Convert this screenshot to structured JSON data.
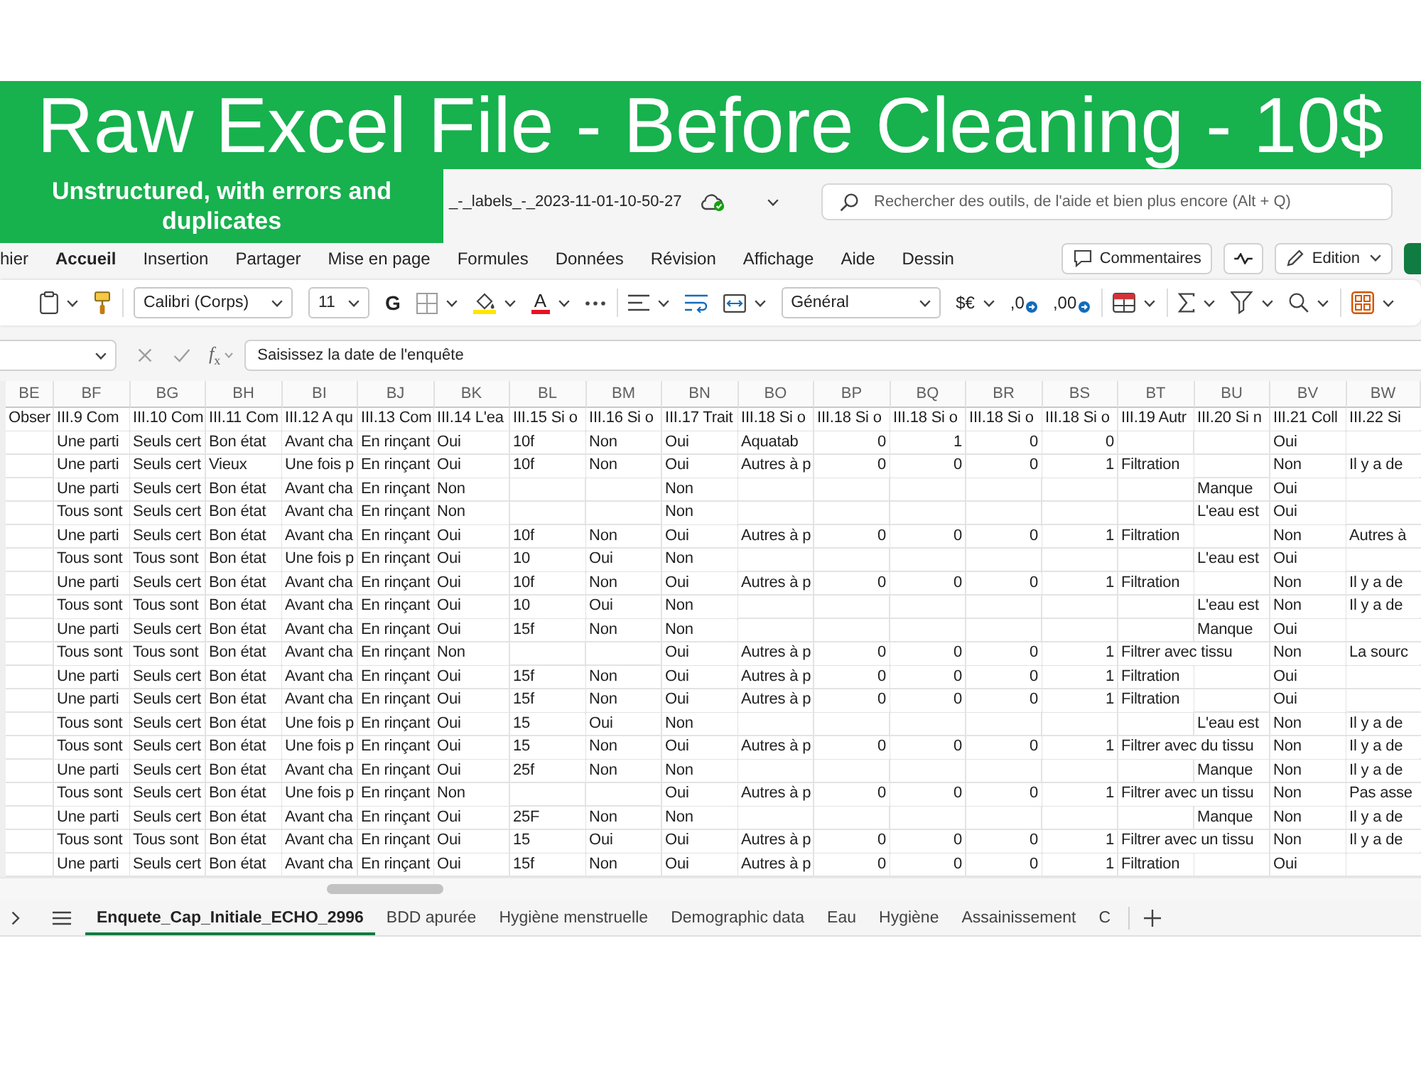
{
  "banner": {
    "title": "Raw Excel File - Before Cleaning - 10$",
    "note": "Unstructured, with errors and duplicates"
  },
  "title_bar": {
    "file_name": "_-_labels_-_2023-11-01-10-50-27",
    "search": {
      "placeholder": "Rechercher des outils, de l'aide et bien plus encore (Alt + Q)"
    }
  },
  "menu_tabs": [
    {
      "label": "hier",
      "selected": false
    },
    {
      "label": "Accueil",
      "selected": true
    },
    {
      "label": "Insertion",
      "selected": false
    },
    {
      "label": "Partager",
      "selected": false
    },
    {
      "label": "Mise en page",
      "selected": false
    },
    {
      "label": "Formules",
      "selected": false
    },
    {
      "label": "Données",
      "selected": false
    },
    {
      "label": "Révision",
      "selected": false
    },
    {
      "label": "Affichage",
      "selected": false
    },
    {
      "label": "Aide",
      "selected": false
    },
    {
      "label": "Dessin",
      "selected": false
    }
  ],
  "menu_actions": [
    {
      "kind": "comments",
      "label": "Commentaires"
    },
    {
      "kind": "activity"
    },
    {
      "kind": "editing",
      "label": "Edition"
    },
    {
      "kind": "share"
    }
  ],
  "ribbon": [
    {
      "kind": "clipboard"
    },
    {
      "kind": "format-painter"
    },
    {
      "kind": "separator"
    },
    {
      "kind": "font",
      "value": "Calibri (Corps)"
    },
    {
      "kind": "size",
      "value": "11"
    },
    {
      "kind": "bold",
      "label": "G"
    },
    {
      "kind": "borders"
    },
    {
      "kind": "fill-color"
    },
    {
      "kind": "font-color",
      "label": "A"
    },
    {
      "kind": "more"
    },
    {
      "kind": "separator"
    },
    {
      "kind": "align"
    },
    {
      "kind": "wrap"
    },
    {
      "kind": "merge"
    },
    {
      "kind": "number-format",
      "value": "Général"
    },
    {
      "kind": "currency",
      "label": "$€"
    },
    {
      "kind": "add-decimal",
      "label": ",0"
    },
    {
      "kind": "remove-decimal",
      "label": ",00"
    },
    {
      "kind": "separator"
    },
    {
      "kind": "cell-format"
    },
    {
      "kind": "separator"
    },
    {
      "kind": "sum"
    },
    {
      "kind": "sort-filter"
    },
    {
      "kind": "find"
    },
    {
      "kind": "separator"
    },
    {
      "kind": "styles"
    }
  ],
  "formula_bar": {
    "function_label": "*f*$_{x}$",
    "value": "Saisissez la date de l'enquête"
  },
  "sheet": {
    "columns": [
      {
        "label": "BE"
      },
      {
        "label": "BF",
        "numeric": false
      },
      {
        "label": "BG",
        "numeric": false
      },
      {
        "label": "BH",
        "numeric": false
      },
      {
        "label": "BI",
        "numeric": false
      },
      {
        "label": "BJ"
      },
      {
        "label": "BK",
        "numeric": false
      },
      {
        "label": "BL",
        "numeric": false
      },
      {
        "label": "BM",
        "numeric": false
      },
      {
        "label": "BN",
        "numeric": false
      },
      {
        "label": "BO",
        "numeric": false
      },
      {
        "label": "BP",
        "numeric": true
      },
      {
        "label": "BQ",
        "numeric": true
      },
      {
        "label": "BR",
        "numeric": true
      },
      {
        "label": "BS",
        "numeric": true
      },
      {
        "label": "BT",
        "numeric": false
      },
      {
        "label": "BU",
        "numeric": false
      },
      {
        "label": "BV",
        "numeric": false
      },
      {
        "label": "BW",
        "numeric": false
      }
    ],
    "header_row": [
      "Obser",
      "III.9 Com",
      "III.10 Com",
      "III.11 Com",
      "III.12 A qu",
      "III.13 Com",
      "III.14 L'ea",
      "III.15 Si o",
      "III.16 Si o",
      "III.17 Trait",
      "III.18 Si o",
      "III.18 Si o",
      "III.18 Si o",
      "III.18 Si o",
      "III.18 Si o",
      "III.19 Autr",
      "III.20 Si n",
      "III.21 Coll",
      "III.22 Si"
    ],
    "rows": [
      [
        null,
        "Une parti",
        "Seuls cert",
        "Bon état",
        "Avant cha",
        "En rinçant",
        "Oui",
        "10f",
        "Non",
        "Oui",
        "Aquatab",
        "0",
        "1",
        "0",
        "0",
        null,
        null,
        "Oui",
        null
      ],
      [
        null,
        "Une parti",
        "Seuls cert",
        "Vieux",
        "Une fois p",
        "En rinçant",
        "Oui",
        "10f",
        "Non",
        "Oui",
        "Autres à p",
        "0",
        "0",
        "0",
        "1",
        "Filtration",
        null,
        "Non",
        "Il y a de"
      ],
      [
        null,
        "Une parti",
        "Seuls cert",
        "Bon état",
        "Avant cha",
        "En rinçant",
        "Non",
        null,
        null,
        "Non",
        null,
        null,
        null,
        null,
        null,
        null,
        "Manque",
        "Oui",
        null
      ],
      [
        null,
        "Tous sont",
        "Seuls cert",
        "Bon état",
        "Avant cha",
        "En rinçant",
        "Non",
        null,
        null,
        "Non",
        null,
        null,
        null,
        null,
        null,
        null,
        "L'eau est",
        "Oui",
        null
      ],
      [
        null,
        "Une parti",
        "Seuls cert",
        "Bon état",
        "Avant cha",
        "En rinçant",
        "Oui",
        "10f",
        "Non",
        "Oui",
        "Autres à p",
        "0",
        "0",
        "0",
        "1",
        "Filtration",
        null,
        "Non",
        "Autres à"
      ],
      [
        null,
        "Tous sont",
        "Tous sont",
        "Bon état",
        "Une fois p",
        "En rinçant",
        "Oui",
        "10",
        "Oui",
        "Non",
        null,
        null,
        null,
        null,
        null,
        null,
        "L'eau est",
        "Oui",
        null
      ],
      [
        null,
        "Une parti",
        "Seuls cert",
        "Bon état",
        "Avant cha",
        "En rinçant",
        "Oui",
        "10f",
        "Non",
        "Oui",
        "Autres à p",
        "0",
        "0",
        "0",
        "1",
        "Filtration",
        null,
        "Non",
        "Il y a de"
      ],
      [
        null,
        "Tous sont",
        "Tous sont",
        "Bon état",
        "Avant cha",
        "En rinçant",
        "Oui",
        "10",
        "Oui",
        "Non",
        null,
        null,
        null,
        null,
        null,
        null,
        "L'eau est",
        "Non",
        "Il y a de"
      ],
      [
        null,
        "Une parti",
        "Seuls cert",
        "Bon état",
        "Avant cha",
        "En rinçant",
        "Oui",
        "15f",
        "Non",
        "Non",
        null,
        null,
        null,
        null,
        null,
        null,
        "Manque",
        "Oui",
        null
      ],
      [
        null,
        "Tous sont",
        "Tous sont",
        "Bon état",
        "Avant cha",
        "En rinçant",
        "Non",
        null,
        null,
        "Oui",
        "Autres à p",
        "0",
        "0",
        "0",
        "1",
        "Filtrer avec tissu",
        null,
        "Non",
        "La sourc"
      ],
      [
        null,
        "Une parti",
        "Seuls cert",
        "Bon état",
        "Avant cha",
        "En rinçant",
        "Oui",
        "15f",
        "Non",
        "Oui",
        "Autres à p",
        "0",
        "0",
        "0",
        "1",
        "Filtration",
        null,
        "Oui",
        null
      ],
      [
        null,
        "Une parti",
        "Seuls cert",
        "Bon état",
        "Avant cha",
        "En rinçant",
        "Oui",
        "15f",
        "Non",
        "Oui",
        "Autres à p",
        "0",
        "0",
        "0",
        "1",
        "Filtration",
        null,
        "Oui",
        null
      ],
      [
        null,
        "Tous sont",
        "Seuls cert",
        "Bon état",
        "Une fois p",
        "En rinçant",
        "Oui",
        "15",
        "Oui",
        "Non",
        null,
        null,
        null,
        null,
        null,
        null,
        "L'eau est",
        "Non",
        "Il y a de"
      ],
      [
        null,
        "Tous sont",
        "Seuls cert",
        "Bon état",
        "Une fois p",
        "En rinçant",
        "Oui",
        "15",
        "Non",
        "Oui",
        "Autres à p",
        "0",
        "0",
        "0",
        "1",
        "Filtrer avec du tissu",
        null,
        "Non",
        "Il y a de"
      ],
      [
        null,
        "Une parti",
        "Seuls cert",
        "Bon état",
        "Avant cha",
        "En rinçant",
        "Oui",
        "25f",
        "Non",
        "Non",
        null,
        null,
        null,
        null,
        null,
        null,
        "Manque",
        "Non",
        "Il y a de"
      ],
      [
        null,
        "Tous sont",
        "Seuls cert",
        "Bon état",
        "Une fois p",
        "En rinçant",
        "Non",
        null,
        null,
        "Oui",
        "Autres à p",
        "0",
        "0",
        "0",
        "1",
        "Filtrer avec un tissu",
        null,
        "Non",
        "Pas asse"
      ],
      [
        null,
        "Une parti",
        "Seuls cert",
        "Bon état",
        "Avant cha",
        "En rinçant",
        "Oui",
        "25F",
        "Non",
        "Non",
        null,
        null,
        null,
        null,
        null,
        null,
        "Manque",
        "Non",
        "Il y a de"
      ],
      [
        null,
        "Tous sont",
        "Tous sont",
        "Bon état",
        "Avant cha",
        "En rinçant",
        "Oui",
        "15",
        "Oui",
        "Oui",
        "Autres à p",
        "0",
        "0",
        "0",
        "1",
        "Filtrer avec un tissu",
        null,
        "Non",
        "Il y a de"
      ],
      [
        null,
        "Une parti",
        "Seuls cert",
        "Bon état",
        "Avant cha",
        "En rinçant",
        "Oui",
        "15f",
        "Non",
        "Oui",
        "Autres à p",
        "0",
        "0",
        "0",
        "1",
        "Filtration",
        null,
        "Oui",
        null
      ]
    ]
  },
  "sheet_tabs": [
    {
      "label": "Enquete_Cap_Initiale_ECHO_2996",
      "selected": true
    },
    {
      "label": "BDD apurée",
      "selected": false
    },
    {
      "label": "Hygiène menstruelle",
      "selected": false
    },
    {
      "label": "Demographic data",
      "selected": false
    },
    {
      "label": "Eau",
      "selected": false
    },
    {
      "label": "Hygiène",
      "selected": false
    },
    {
      "label": "Assainissement",
      "selected": false
    },
    {
      "label": "C",
      "selected": false
    }
  ]
}
